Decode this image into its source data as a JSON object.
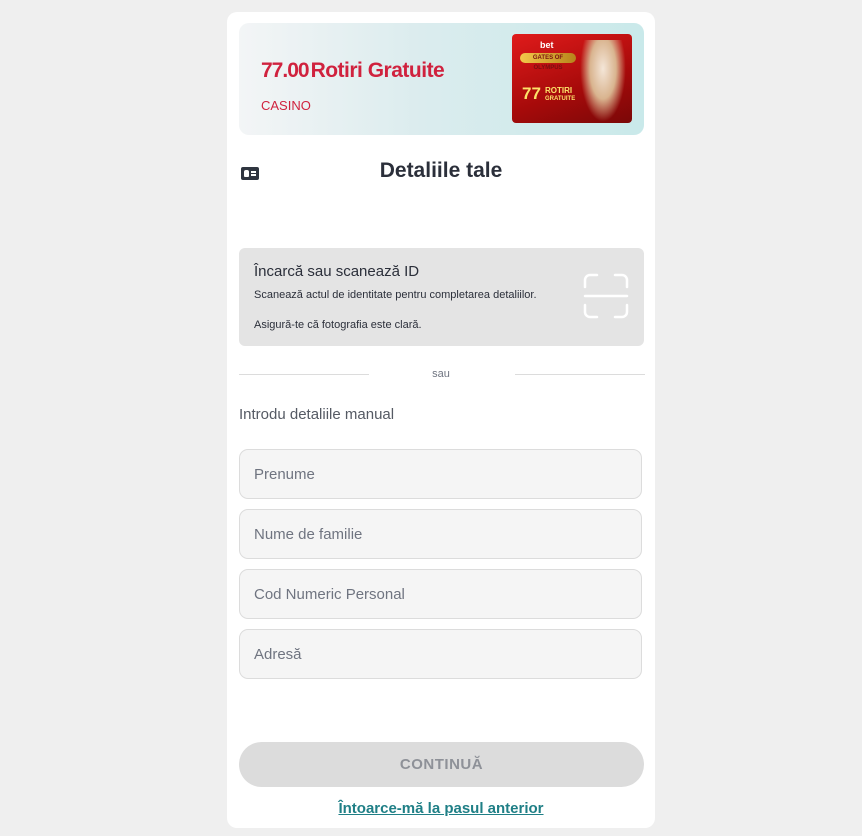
{
  "promo": {
    "amount": "77.00",
    "label": "Rotiri Gratuite",
    "category": "CASINO",
    "image": {
      "brand": "bet",
      "banner": "GATES OF OLYMPUS",
      "number": "77",
      "text_line1": "ROTIRI",
      "text_line2": "GRATUITE"
    }
  },
  "header": {
    "icon": "id-card-icon",
    "title": "Detaliile tale"
  },
  "scan": {
    "title": "Încarcă sau scanează ID",
    "description": "Scanează actul de identitate pentru completarea detaliilor.",
    "hint": "Asigură-te că fotografia este clară.",
    "icon": "scan-frame-icon"
  },
  "divider": {
    "text": "sau"
  },
  "manual": {
    "label": "Introdu detaliile manual",
    "fields": {
      "first_name": {
        "placeholder": "Prenume",
        "value": ""
      },
      "last_name": {
        "placeholder": "Nume de familie",
        "value": ""
      },
      "cnp": {
        "placeholder": "Cod Numeric Personal",
        "value": ""
      },
      "address": {
        "placeholder": "Adresă",
        "value": ""
      }
    }
  },
  "actions": {
    "continue_label": "CONTINUĂ",
    "back_label": "Întoarce-mă la pasul anterior"
  },
  "colors": {
    "accent_red": "#d0223e",
    "link_teal": "#1f7f86",
    "disabled_button": "#dcdcdc"
  }
}
